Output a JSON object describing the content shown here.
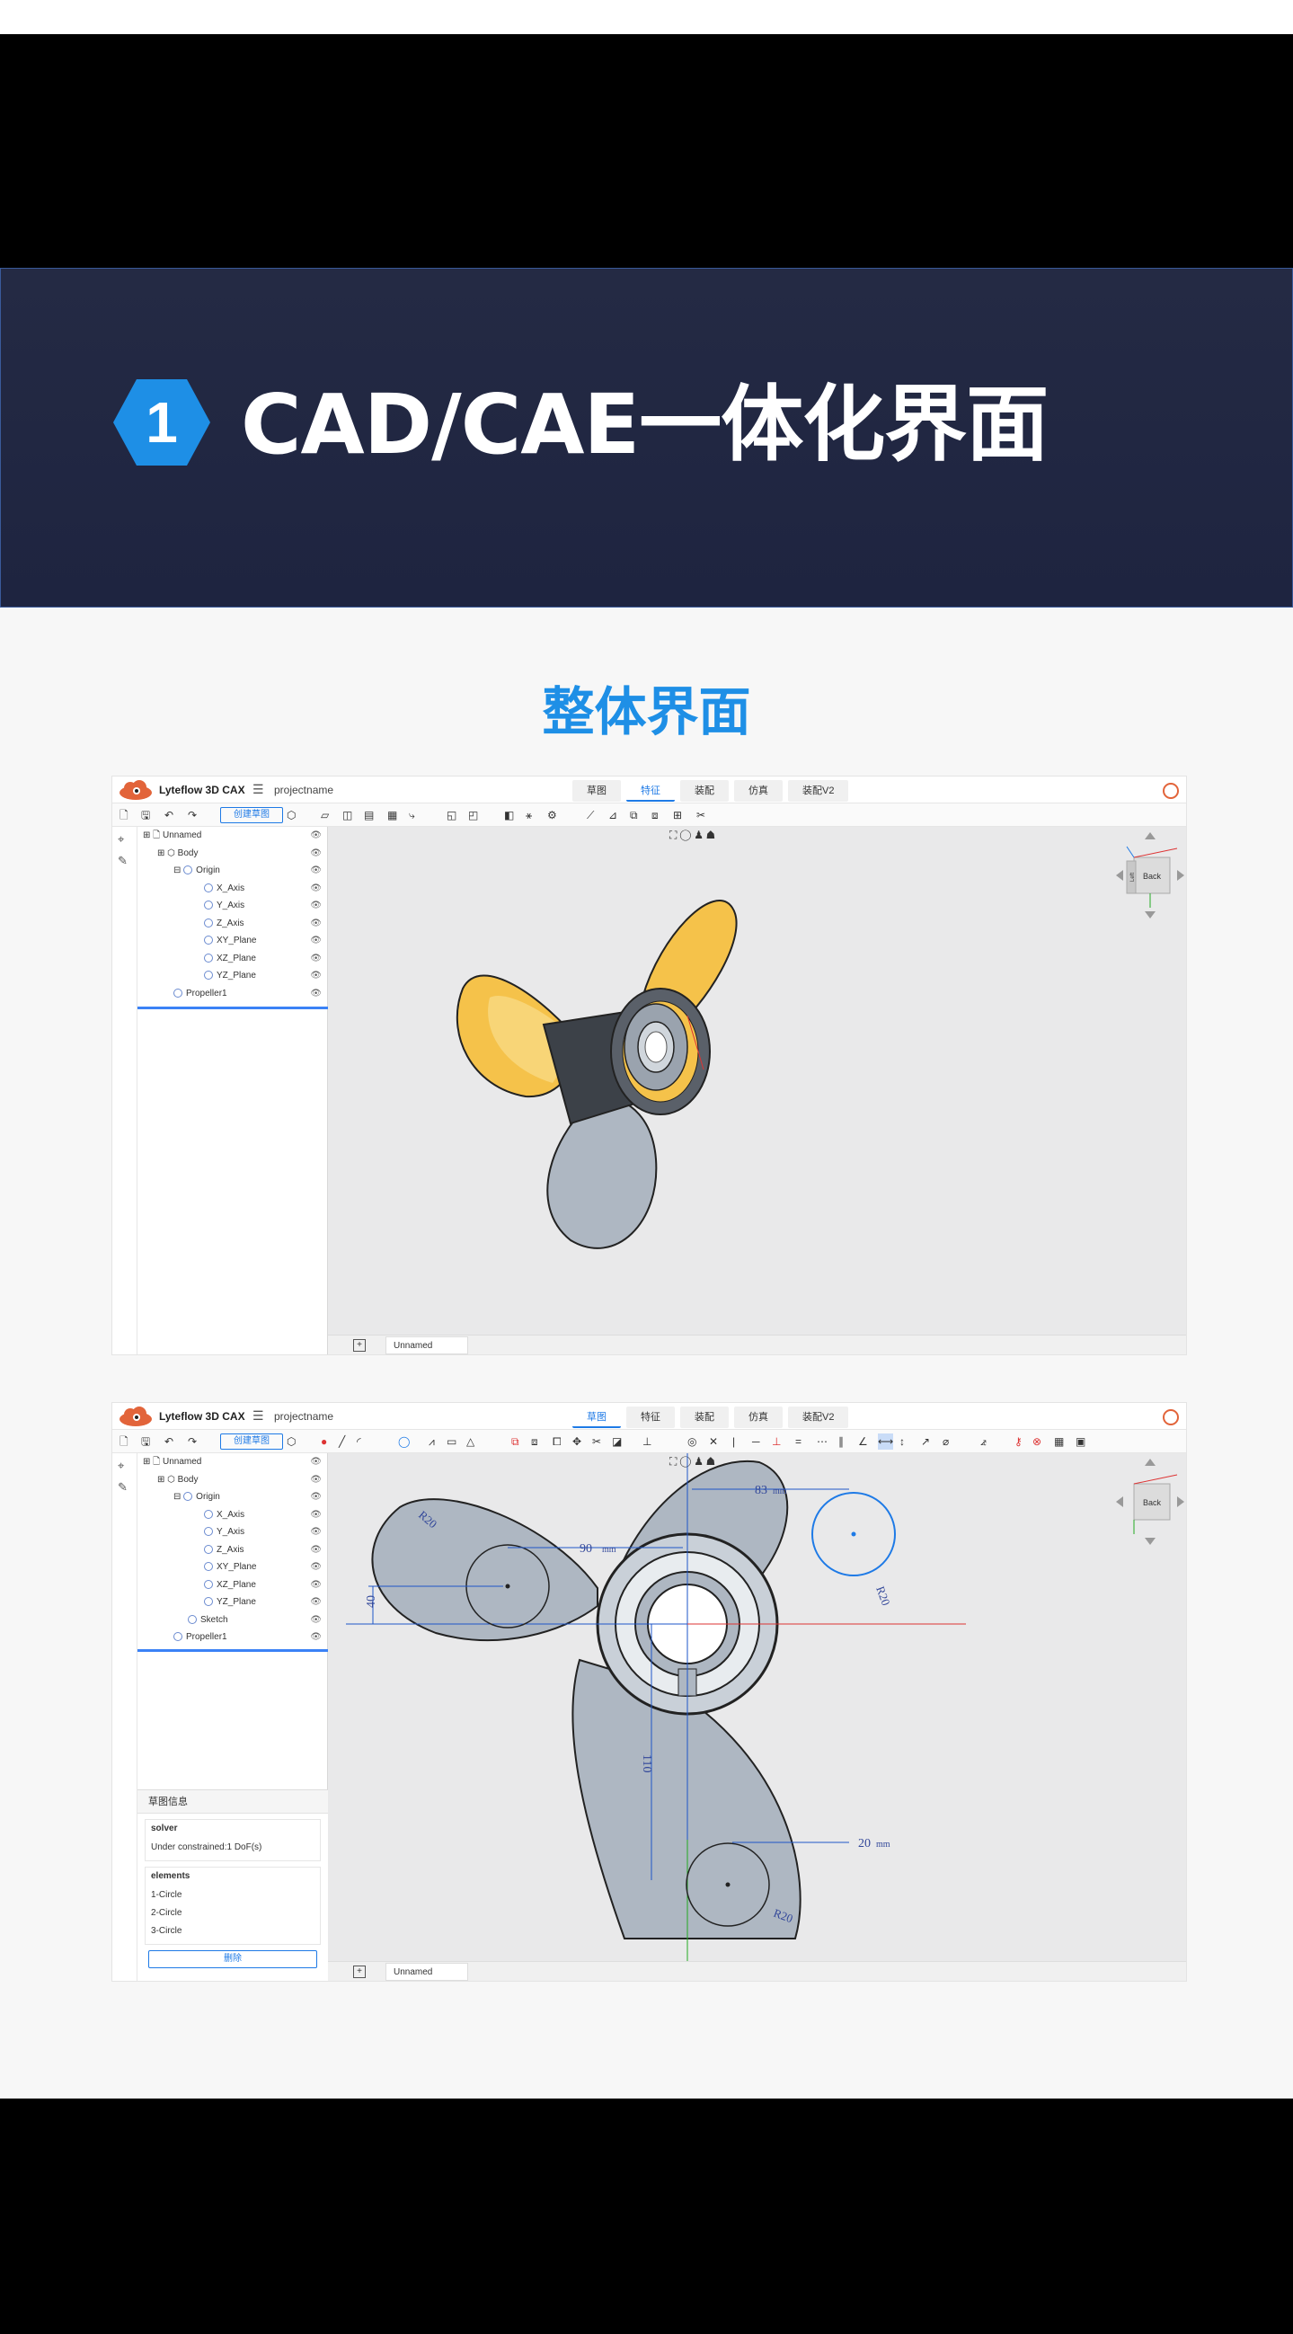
{
  "hero": {
    "badge_number": "1",
    "title": "CAD/CAE一体化界面"
  },
  "section_title": "整体界面",
  "app": {
    "name": "Lyteflow 3D CAX",
    "project": "projectname",
    "tabs": [
      "草图",
      "特征",
      "装配",
      "仿真",
      "装配V2"
    ],
    "create_sketch": "创建草图",
    "document_tab": "Unnamed",
    "add_icon": "plus-icon"
  },
  "screenshot1": {
    "active_tab": "特征",
    "tree": [
      "Unnamed",
      "Body",
      "Origin",
      "X_Axis",
      "Y_Axis",
      "Z_Axis",
      "XY_Plane",
      "XZ_Plane",
      "YZ_Plane",
      "Propeller1"
    ],
    "viewcube_labels": {
      "front": "Back",
      "left": "Left"
    }
  },
  "screenshot2": {
    "active_tab": "草图",
    "tree": [
      "Unnamed",
      "Body",
      "Origin",
      "X_Axis",
      "Y_Axis",
      "Z_Axis",
      "XY_Plane",
      "XZ_Plane",
      "YZ_Plane",
      "Sketch",
      "Propeller1"
    ],
    "viewcube_labels": {
      "front": "Back"
    },
    "info": {
      "header": "草图信息",
      "solver_label": "solver",
      "solver_status": "Under constrained:1 DoF(s)",
      "elements_label": "elements",
      "elements": [
        "1-Circle",
        "2-Circle",
        "3-Circle"
      ],
      "delete": "删除"
    },
    "dims": {
      "d83": "83",
      "d90": "90",
      "d40": "40",
      "d110": "110",
      "d20": "20",
      "r20a": "R20",
      "r20b": "R20",
      "r20c": "R20",
      "unit": "mm"
    }
  },
  "colors": {
    "hero_bg": "#242a44",
    "accent_blue": "#1e8fe6",
    "tab_active": "#1e7ae6",
    "blade_yellow": "#f5c24a",
    "propeller_gray": "#aeb7c2"
  }
}
